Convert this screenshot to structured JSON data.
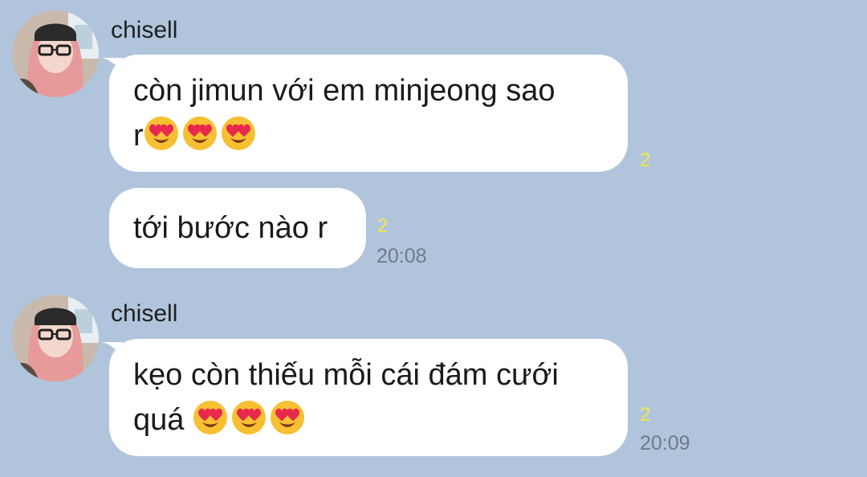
{
  "conversation": {
    "groups": [
      {
        "sender": "chisell",
        "messages": [
          {
            "lines": [
              "còn jimun với em minjeong sao",
              "r"
            ],
            "emoji_count": 3,
            "emoji": "smiling-face-with-heart-eyes",
            "read_count": "2"
          },
          {
            "lines": [
              "tới bước nào r"
            ],
            "read_count": "2",
            "time": "20:08"
          }
        ]
      },
      {
        "sender": "chisell",
        "messages": [
          {
            "lines": [
              "kẹo còn thiếu mỗi cái đám cưới",
              "quá "
            ],
            "emoji_count": 3,
            "emoji": "smiling-face-with-heart-eyes",
            "read_count": "2",
            "time": "20:09"
          }
        ]
      }
    ]
  },
  "colors": {
    "background": "#b0c5dc",
    "bubble": "#ffffff",
    "read_count": "#f4e54b",
    "timestamp": "#6d7b8a"
  }
}
